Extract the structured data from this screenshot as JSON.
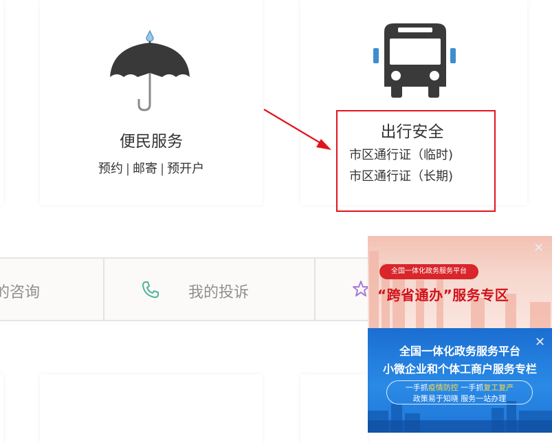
{
  "services": {
    "convenience": {
      "title": "便民服务",
      "links": [
        "预约",
        "邮寄",
        "预开户"
      ],
      "separator": "|",
      "icon": "umbrella-icon"
    },
    "travel": {
      "title": "出行安全",
      "links": [
        "市区通行证（临时)",
        "市区通行证（长期)"
      ],
      "icon": "bus-icon"
    }
  },
  "quick_bar": {
    "consult_label": "的咨询",
    "complaint_label": "我的投诉",
    "complaint_icon": "phone-icon",
    "star_icon": "star-icon"
  },
  "banner": {
    "top": {
      "pill_text": "全国一体化政务服务平台",
      "title": "“跨省通办”服务专区"
    },
    "bottom": {
      "line1": "全国一体化政务服务平台",
      "line2": "小微企业和个体工商户服务专栏",
      "slogan_part1": "一手抓",
      "slogan_highlight1": "疫情防控",
      "slogan_part2": " 一手抓",
      "slogan_highlight2": "复工复产",
      "slogan_line2": "政策易于知晓 服务一站办理"
    },
    "close_symbol": "✕"
  },
  "colors": {
    "annotation_red": "#e2141b",
    "banner_red": "#d0121b",
    "banner_blue": "#1b6ed1",
    "text_dark": "#333333",
    "text_gray": "#8f8f8f"
  }
}
